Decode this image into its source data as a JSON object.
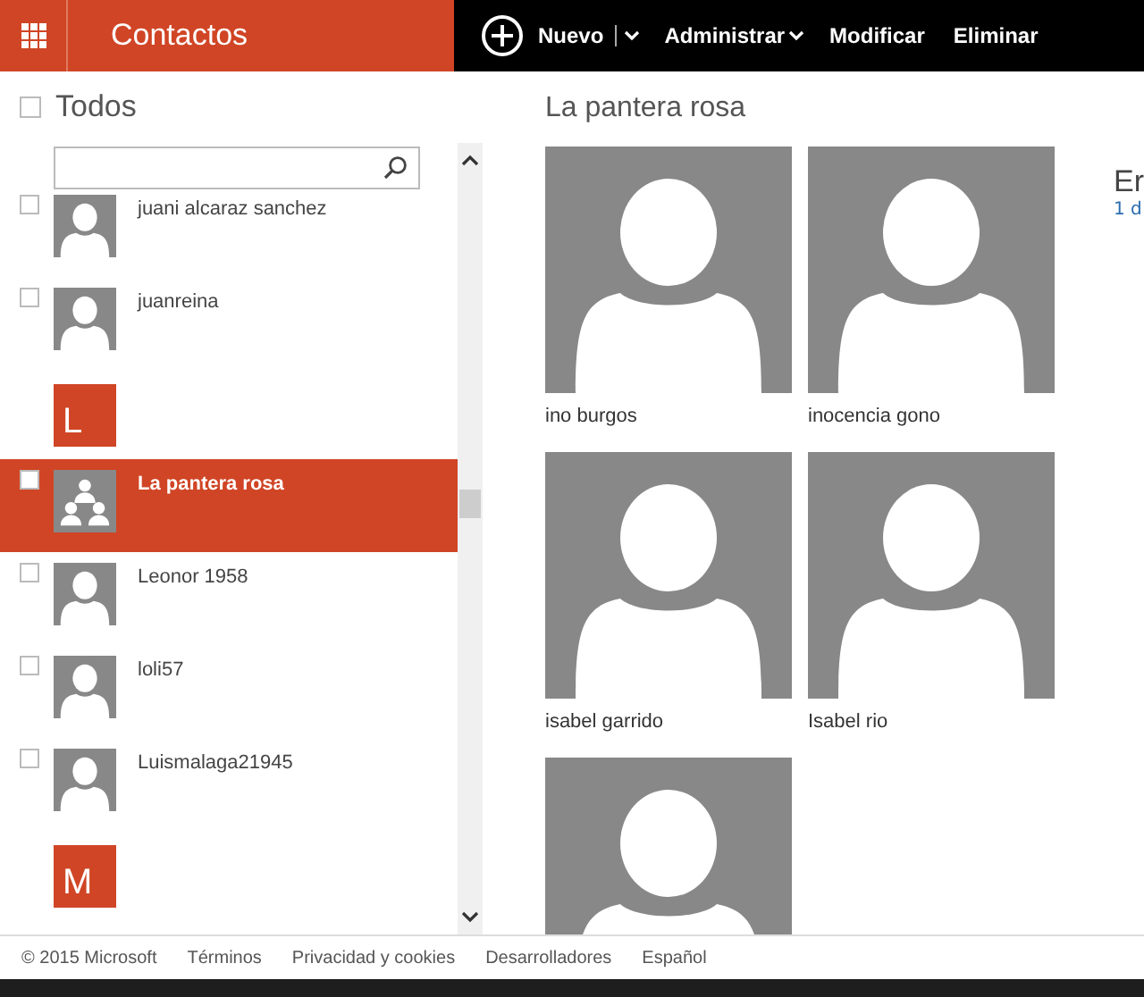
{
  "app_title": "Contactos",
  "commands": [
    {
      "label": "Nuevo",
      "kind": "new"
    },
    {
      "label": "Administrar",
      "kind": "menu"
    },
    {
      "label": "Modificar",
      "kind": "plain"
    },
    {
      "label": "Eliminar",
      "kind": "plain"
    }
  ],
  "list_header": {
    "label": "Todos",
    "checked": false
  },
  "contacts": [
    {
      "kind": "contact",
      "name": "juani alcaraz sanchez",
      "selected": false
    },
    {
      "kind": "contact",
      "name": "juanreina",
      "selected": false
    },
    {
      "kind": "letter",
      "name": "L"
    },
    {
      "kind": "group",
      "name": "La pantera rosa",
      "selected": true
    },
    {
      "kind": "contact",
      "name": "Leonor 1958",
      "selected": false
    },
    {
      "kind": "contact",
      "name": "loli57",
      "selected": false
    },
    {
      "kind": "contact",
      "name": "Luismalaga21945",
      "selected": false
    },
    {
      "kind": "letter",
      "name": "M"
    }
  ],
  "detail": {
    "title": "La pantera rosa",
    "members": [
      {
        "kind": "member",
        "name": "ino burgos"
      },
      {
        "kind": "member",
        "name": "inocencia gono"
      },
      {
        "kind": "member",
        "name": "isabel garrido"
      },
      {
        "kind": "member",
        "name": "Isabel rio"
      },
      {
        "kind": "photo_only"
      }
    ],
    "side_title": "Er",
    "side_text": "1 d"
  },
  "footer": [
    "© 2015 Microsoft",
    "Términos",
    "Privacidad y cookies",
    "Desarrolladores",
    "Español"
  ]
}
